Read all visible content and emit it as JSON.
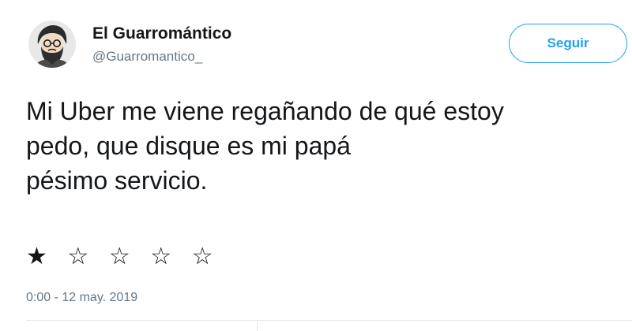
{
  "author": {
    "display_name": "El Guarromántico",
    "handle": "@Guarromantico_",
    "avatar_icon": "bearded-man-avatar-icon"
  },
  "follow_button": {
    "label": "Seguir"
  },
  "tweet": {
    "lines": [
      "Mi Uber me viene regañando de qué estoy",
      "pedo, que disque es mi papá",
      "pésimo servicio."
    ],
    "rating_stars": "★ ☆ ☆ ☆ ☆",
    "rating_value": 1,
    "rating_max": 5,
    "timestamp": "0:00 - 12 may. 2019"
  },
  "colors": {
    "accent": "#1da1f2",
    "text": "#14171a",
    "muted": "#657786"
  }
}
